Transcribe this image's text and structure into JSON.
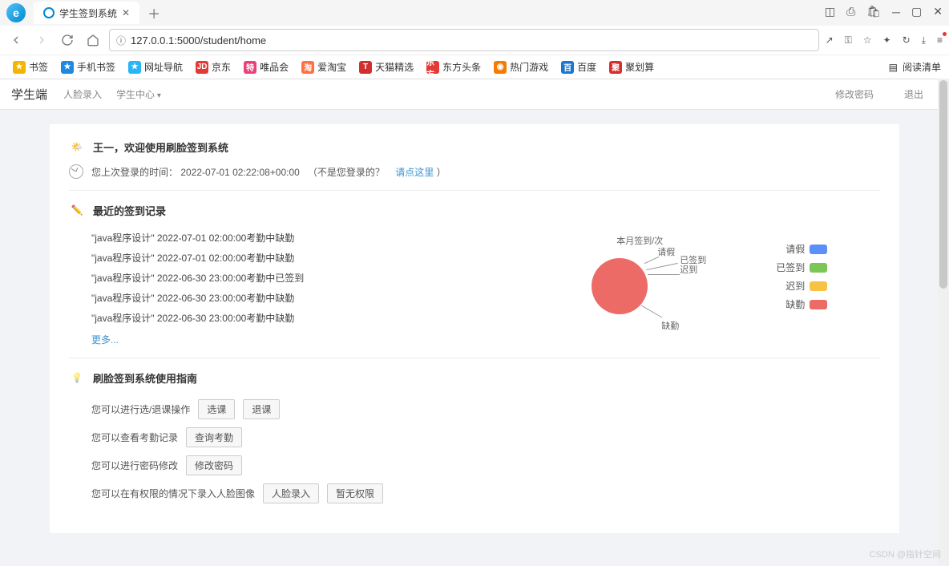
{
  "browser": {
    "tab_title": "学生签到系统",
    "url": "127.0.0.1:5000/student/home",
    "bookmarks": [
      {
        "label": "书签",
        "color": "#f5b400"
      },
      {
        "label": "手机书签",
        "color": "#1e88e5"
      },
      {
        "label": "网址导航",
        "color": "#29b6f6"
      },
      {
        "label": "京东",
        "color": "#e53935",
        "badge": "JD"
      },
      {
        "label": "唯品会",
        "color": "#ec407a",
        "badge": "特"
      },
      {
        "label": "爱淘宝",
        "color": "#ff7043",
        "badge": "淘"
      },
      {
        "label": "天猫精选",
        "color": "#d32f2f",
        "badge": "T"
      },
      {
        "label": "东方头条",
        "color": "#e53935",
        "badge": "东方"
      },
      {
        "label": "热门游戏",
        "color": "#f57c00",
        "badge": "◉"
      },
      {
        "label": "百度",
        "color": "#1976d2",
        "badge": "百"
      },
      {
        "label": "聚划算",
        "color": "#d32f2f",
        "badge": "聚"
      }
    ],
    "read_list": "阅读清单"
  },
  "nav": {
    "brand": "学生端",
    "items": [
      "人脸录入",
      "学生中心"
    ],
    "right": [
      "修改密码",
      "退出"
    ]
  },
  "welcome": {
    "title": "王一，欢迎使用刷脸签到系统",
    "last_login_prefix": "您上次登录的时间：",
    "last_login_time": "2022-07-01 02:22:08+00:00",
    "not_you": "（不是您登录的？",
    "click_here": "请点这里",
    "close_paren": "）"
  },
  "records": {
    "title": "最近的签到记录",
    "items": [
      "\"java程序设计\" 2022-07-01 02:00:00考勤中缺勤",
      "\"java程序设计\" 2022-07-01 02:00:00考勤中缺勤",
      "\"java程序设计\" 2022-06-30 23:00:00考勤中已签到",
      "\"java程序设计\" 2022-06-30 23:00:00考勤中缺勤",
      "\"java程序设计\" 2022-06-30 23:00:00考勤中缺勤"
    ],
    "more": "更多..."
  },
  "chart_data": {
    "type": "pie",
    "title": "本月签到/次",
    "series": [
      {
        "name": "请假",
        "value": 0,
        "color": "#5b8ff9"
      },
      {
        "name": "已签到",
        "value": 0,
        "color": "#7ac756"
      },
      {
        "name": "迟到",
        "value": 0,
        "color": "#f7c344"
      },
      {
        "name": "缺勤",
        "value": 1,
        "color": "#ec6b66"
      }
    ]
  },
  "guide": {
    "title": "刷脸签到系统使用指南",
    "rows": [
      {
        "text": "您可以进行选/退课操作",
        "buttons": [
          "选课",
          "退课"
        ]
      },
      {
        "text": "您可以查看考勤记录",
        "buttons": [
          "查询考勤"
        ]
      },
      {
        "text": "您可以进行密码修改",
        "buttons": [
          "修改密码"
        ]
      },
      {
        "text": "您可以在有权限的情况下录入人脸图像",
        "buttons": [
          "人脸录入",
          "暂无权限"
        ]
      }
    ]
  },
  "watermark": "CSDN @指针空间"
}
